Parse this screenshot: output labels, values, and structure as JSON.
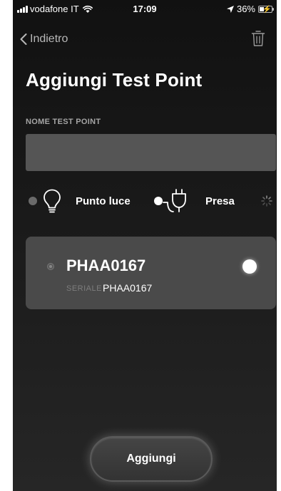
{
  "status_bar": {
    "carrier": "vodafone IT",
    "time": "17:09",
    "battery_percent": "36%",
    "battery_level": 0.36
  },
  "nav": {
    "back_label": "Indietro",
    "delete_icon": "trash-icon"
  },
  "page": {
    "title": "Aggiungi Test Point"
  },
  "name_field": {
    "label": "NOME TEST POINT",
    "value": "",
    "placeholder": ""
  },
  "types": [
    {
      "label": "Punto luce",
      "icon": "light-bulb-icon",
      "selected": false
    },
    {
      "label": "Presa",
      "icon": "plug-icon",
      "selected": true
    }
  ],
  "device": {
    "name": "PHAA0167",
    "serial_label": "SERIALE",
    "serial_value": "PHAA0167"
  },
  "actions": {
    "add_label": "Aggiungi"
  },
  "colors": {
    "background": "#1a1a1a",
    "card": "#4a4a4a",
    "input": "#555555",
    "muted_text": "#a5a5a5"
  }
}
